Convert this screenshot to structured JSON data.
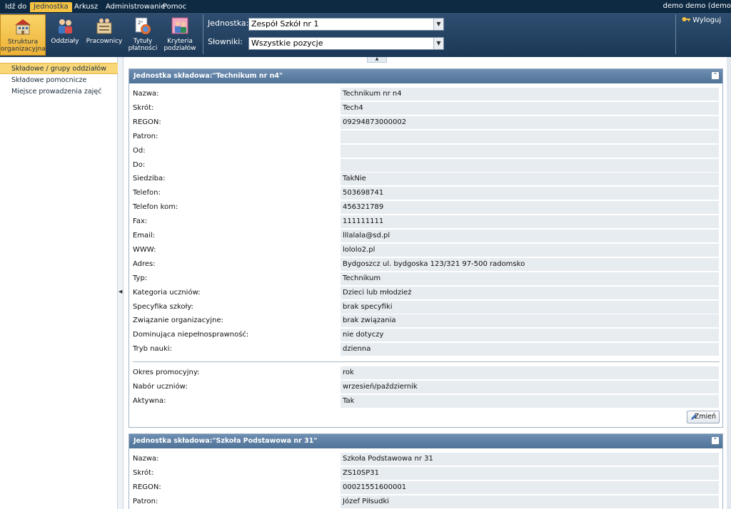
{
  "menubar": {
    "items": [
      "Idź do",
      "Jednostka",
      "Arkusz",
      "Administrowanie",
      "Pomoc"
    ],
    "active_index": 1,
    "user": "demo demo (demo"
  },
  "ribbon": {
    "tools": [
      {
        "label1": "Struktura",
        "label2": "organizacyjna",
        "icon": "building-icon"
      },
      {
        "label1": "Oddziały",
        "label2": "",
        "icon": "students-icon"
      },
      {
        "label1": "Pracownicy",
        "label2": "",
        "icon": "staff-icon"
      },
      {
        "label1": "Tytuły",
        "label2": "płatności",
        "icon": "payment-titles-icon"
      },
      {
        "label1": "Kryteria",
        "label2": "podziałów",
        "icon": "criteria-icon"
      }
    ],
    "jednostka_label": "Jednostka:",
    "jednostka_value": "Zespół Szkół nr 1",
    "slowniki_label": "Słowniki:",
    "slowniki_value": "Wszystkie pozycje",
    "logout_label": "Wyloguj"
  },
  "leftnav": {
    "items": [
      "Składowe / grupy oddziałów",
      "Składowe pomocnicze",
      "Miejsce prowadzenia zajęć"
    ],
    "active_index": 0
  },
  "panel1": {
    "title": "Jednostka składowa:\"Technikum nr n4\"",
    "rows": [
      {
        "label": "Nazwa:",
        "value": "Technikum nr n4"
      },
      {
        "label": "Skrót:",
        "value": "Tech4"
      },
      {
        "label": "REGON:",
        "value": "09294873000002"
      },
      {
        "label": "Patron:",
        "value": ""
      },
      {
        "label": "Od:",
        "value": ""
      },
      {
        "label": "Do:",
        "value": ""
      },
      {
        "label": "Siedziba:",
        "value": "TakNie"
      },
      {
        "label": "Telefon:",
        "value": "503698741"
      },
      {
        "label": "Telefon kom:",
        "value": "456321789"
      },
      {
        "label": "Fax:",
        "value": "111111111"
      },
      {
        "label": "Email:",
        "value": "lllalala@sd.pl"
      },
      {
        "label": "WWW:",
        "value": "lololo2.pl"
      },
      {
        "label": "Adres:",
        "value": "Bydgoszcz ul. bydgoska 123/321 97-500 radomsko"
      },
      {
        "label": "Typ:",
        "value": "Technikum"
      },
      {
        "label": "Kategoria uczniów:",
        "value": "Dzieci lub młodzież"
      },
      {
        "label": "Specyfika szkoły:",
        "value": "brak specyfiki"
      },
      {
        "label": "Związanie organizacyjne:",
        "value": "brak związania"
      },
      {
        "label": "Dominująca niepełnosprawność:",
        "value": "nie dotyczy"
      },
      {
        "label": "Tryb nauki:",
        "value": "dzienna"
      }
    ],
    "rows2": [
      {
        "label": "Okres promocyjny:",
        "value": "rok"
      },
      {
        "label": "Nabór uczniów:",
        "value": "wrzesień/październik"
      },
      {
        "label": "Aktywna:",
        "value": "Tak"
      }
    ],
    "edit_label": "Zmień"
  },
  "panel2": {
    "title": "Jednostka składowa:\"Szkoła Podstawowa nr 31\"",
    "rows": [
      {
        "label": "Nazwa:",
        "value": "Szkoła Podstawowa nr 31"
      },
      {
        "label": "Skrót:",
        "value": "ZS10SP31"
      },
      {
        "label": "REGON:",
        "value": "00021551600001"
      },
      {
        "label": "Patron:",
        "value": "Józef Piłsudki"
      }
    ]
  }
}
